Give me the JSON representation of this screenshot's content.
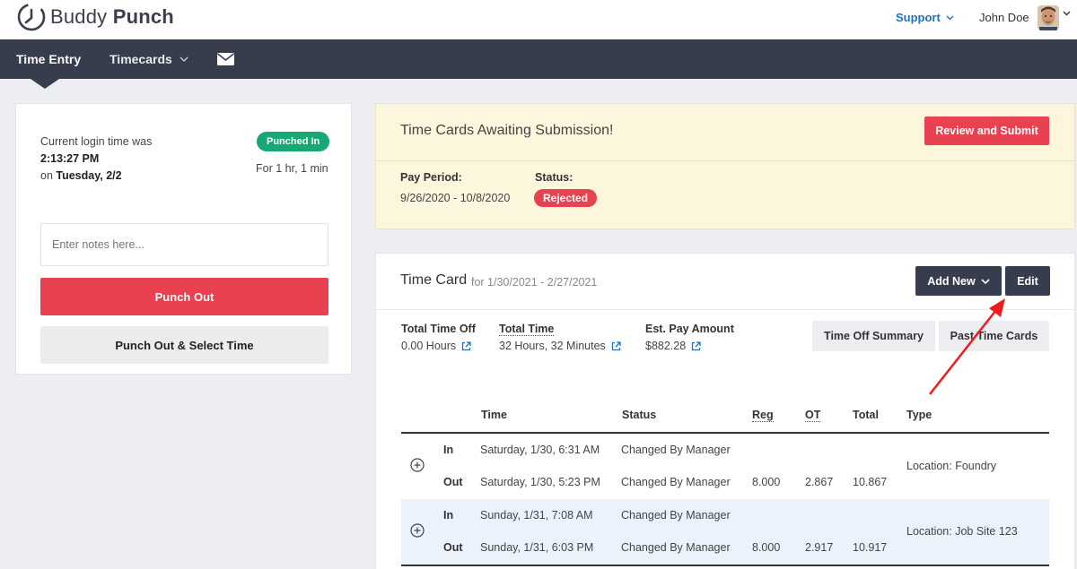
{
  "header": {
    "brand_light": "Buddy ",
    "brand_bold": "Punch",
    "support_label": "Support",
    "user_name": "John Doe"
  },
  "nav": {
    "time_entry": "Time Entry",
    "timecards": "Timecards",
    "mail_icon": "envelope-icon"
  },
  "punch": {
    "login_line1": "Current login time was",
    "login_time": "2:13:27 PM",
    "login_on": "on",
    "login_day": "Tuesday, 2/2",
    "status_badge": "Punched In",
    "duration": "For 1 hr, 1 min",
    "notes_placeholder": "Enter notes here...",
    "punch_out_label": "Punch Out",
    "punch_out_select_label": "Punch Out & Select Time"
  },
  "awaiting": {
    "title": "Time Cards Awaiting Submission!",
    "review_label": "Review and Submit",
    "pay_period_label": "Pay Period:",
    "pay_period_value": "9/26/2020 - 10/8/2020",
    "status_label": "Status:",
    "status_value": "Rejected"
  },
  "timecard": {
    "title": "Time Card",
    "range": "for 1/30/2021 - 2/27/2021",
    "add_new_label": "Add New",
    "edit_label": "Edit",
    "summary": [
      {
        "label": "Total Time Off",
        "value": "0.00 Hours"
      },
      {
        "label": "Total Time",
        "value": "32 Hours, 32 Minutes"
      },
      {
        "label": "Est. Pay Amount",
        "value": "$882.28"
      }
    ],
    "time_off_summary_label": "Time Off Summary",
    "past_time_cards_label": "Past Time Cards",
    "columns": {
      "time": "Time",
      "status": "Status",
      "reg": "Reg",
      "ot": "OT",
      "total": "Total",
      "type": "Type"
    },
    "entries": [
      {
        "in_label": "In",
        "in_time": "Saturday, 1/30, 6:31 AM",
        "in_status": "Changed By Manager",
        "out_label": "Out",
        "out_time": "Saturday, 1/30, 5:23 PM",
        "out_status": "Changed By Manager",
        "reg": "8.000",
        "ot": "2.867",
        "total": "10.867",
        "type": "Location: Foundry"
      },
      {
        "in_label": "In",
        "in_time": "Sunday, 1/31, 7:08 AM",
        "in_status": "Changed By Manager",
        "out_label": "Out",
        "out_time": "Sunday, 1/31, 6:03 PM",
        "out_status": "Changed By Manager",
        "reg": "8.000",
        "ot": "2.917",
        "total": "10.917",
        "type": "Location: Job Site 123"
      }
    ]
  },
  "colors": {
    "nav_bg": "#373d4c",
    "accent_red": "#e8414f",
    "success_green": "#17a873",
    "link_blue": "#1c73c9",
    "warning_bg": "#fbf6dc"
  }
}
